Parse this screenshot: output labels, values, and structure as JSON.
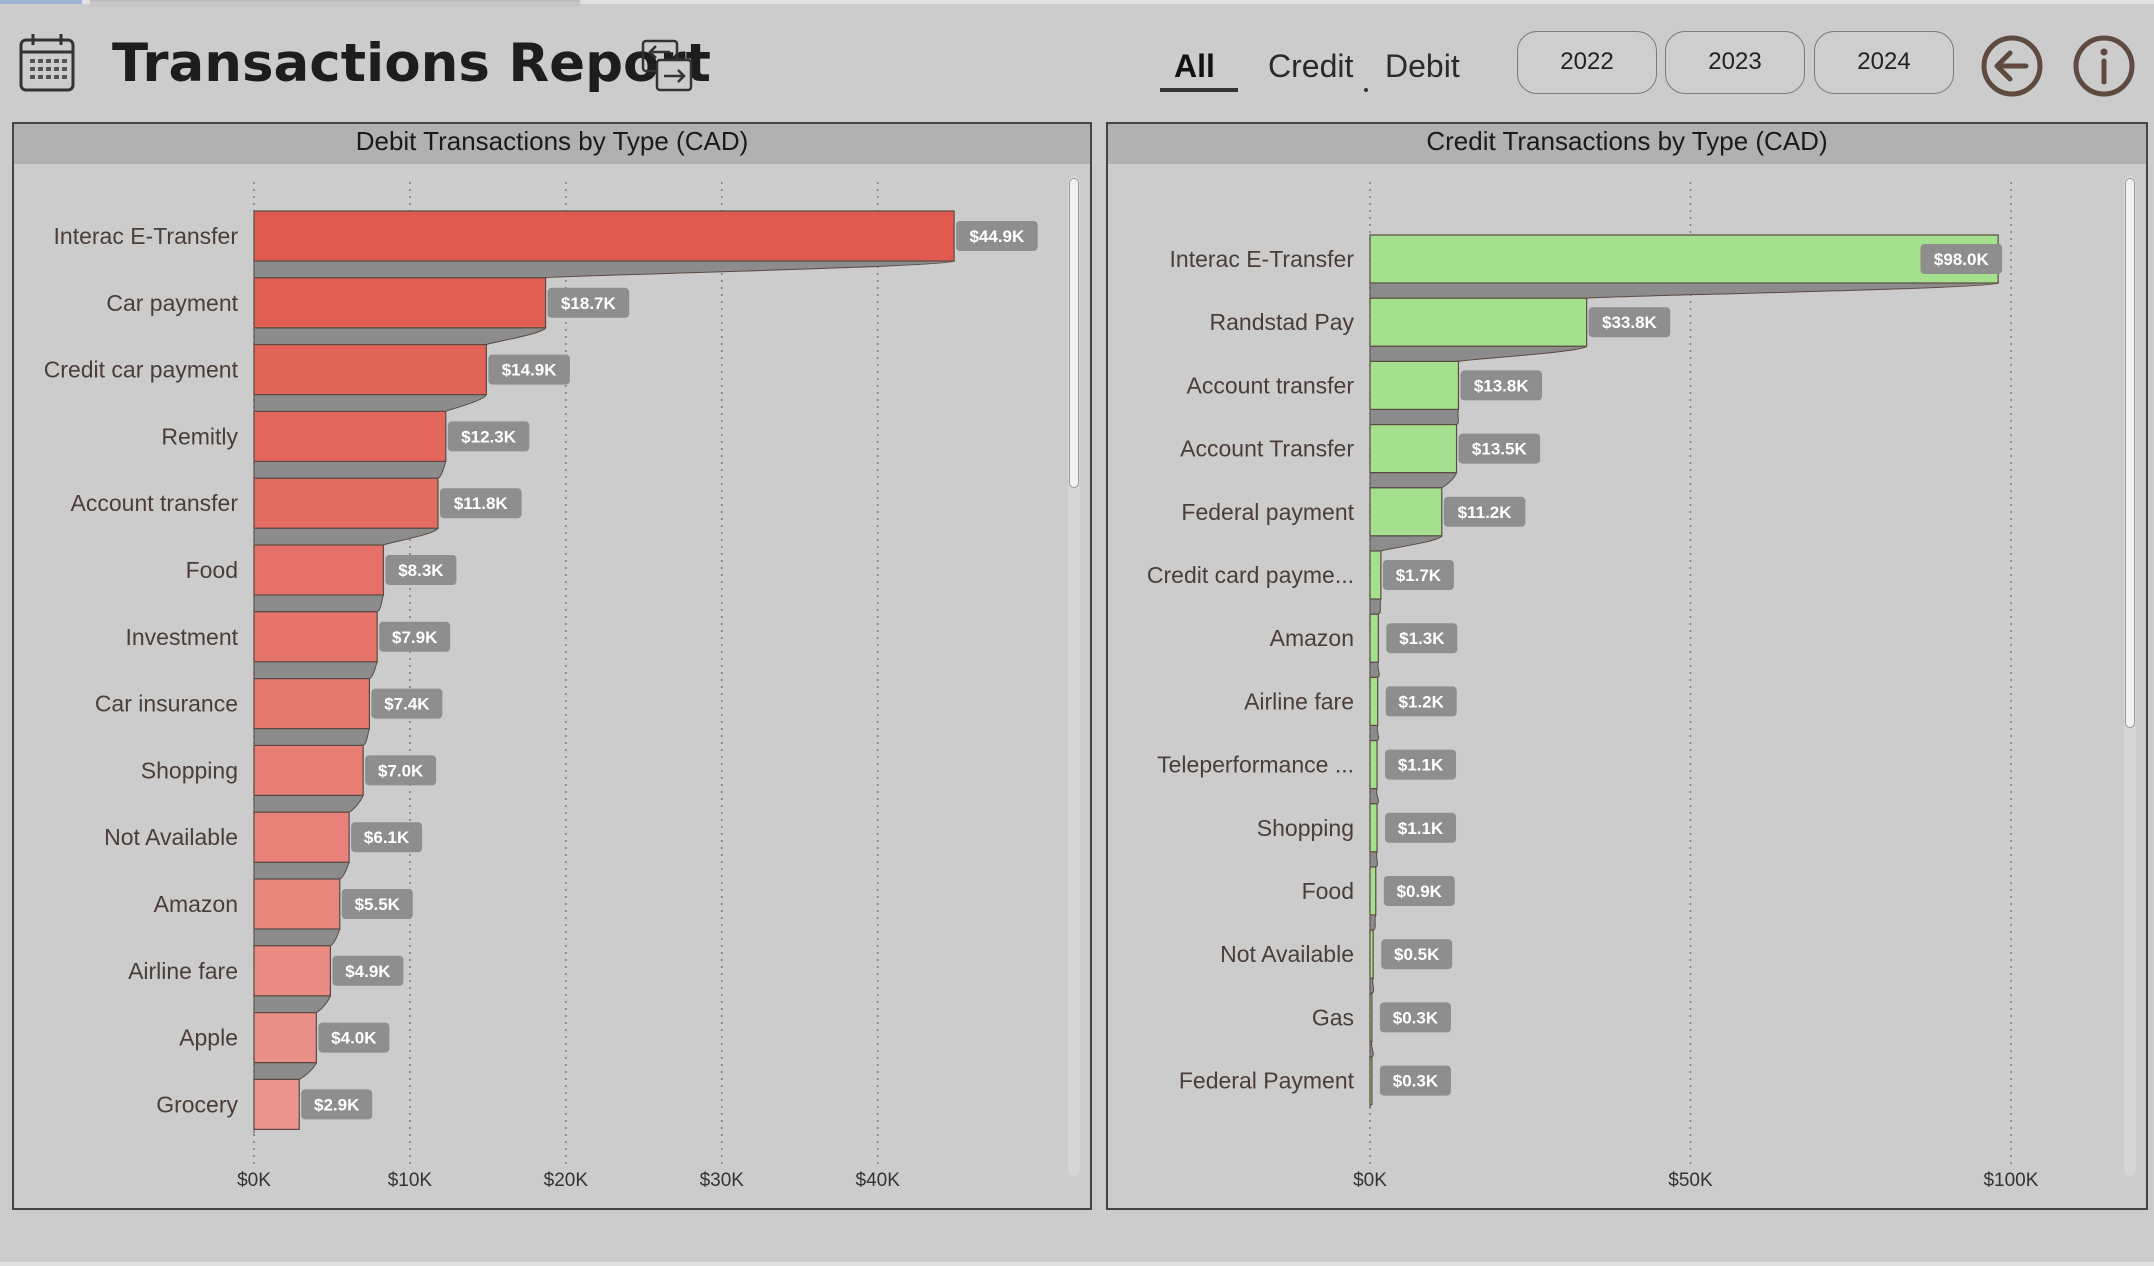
{
  "header": {
    "title": "Transactions Report",
    "icons": {
      "calendar": "calendar-icon",
      "swap": "swap-arrows-icon",
      "back": "arrow-left-circle-icon",
      "info": "info-circle-icon"
    },
    "type_filters": [
      {
        "label": "All",
        "active": true
      },
      {
        "label": "Credit",
        "active": false
      },
      {
        "label": "Debit",
        "active": false
      }
    ],
    "year_filters": [
      "2022",
      "2023",
      "2024"
    ]
  },
  "colors": {
    "background": "#cccccc",
    "panel_header": "#b1b1b1",
    "debit_bar": "#e05a4f",
    "credit_bar": "#a4e08e",
    "data_label_bg": "#8e8e8e",
    "icon_brown": "#5e4a3e"
  },
  "chart_data": [
    {
      "type": "bar",
      "orientation": "horizontal",
      "title": "Debit Transactions by Type (CAD)",
      "categories": [
        "Interac E-Transfer",
        "Car payment",
        "Credit car payment",
        "Remitly",
        "Account transfer",
        "Food",
        "Investment",
        "Car insurance",
        "Shopping",
        "Not Available",
        "Amazon",
        "Airline fare",
        "Apple",
        "Grocery"
      ],
      "values": [
        44.9,
        18.7,
        14.9,
        12.3,
        11.8,
        8.3,
        7.9,
        7.4,
        7.0,
        6.1,
        5.5,
        4.9,
        4.0,
        2.9
      ],
      "value_unit": "K CAD",
      "data_labels": [
        "$44.9K",
        "$18.7K",
        "$14.9K",
        "$12.3K",
        "$11.8K",
        "$8.3K",
        "$7.9K",
        "$7.4K",
        "$7.0K",
        "$6.1K",
        "$5.5K",
        "$4.9K",
        "$4.0K",
        "$2.9K"
      ],
      "x_ticks": [
        0,
        10,
        20,
        30,
        40
      ],
      "x_tick_labels": [
        "$0K",
        "$10K",
        "$20K",
        "$30K",
        "$40K"
      ],
      "xlim": [
        0,
        51.5
      ],
      "grid": "vertical dotted",
      "scrollbar": true
    },
    {
      "type": "bar",
      "orientation": "horizontal",
      "title": "Credit Transactions by Type (CAD)",
      "categories": [
        "Interac E-Transfer",
        "Randstad Pay",
        "Account transfer",
        "Account Transfer",
        "Federal payment",
        "Credit card payme...",
        "Amazon",
        "Airline fare",
        "Teleperformance ...",
        "Shopping",
        "Food",
        "Not Available",
        "Gas",
        "Federal Payment"
      ],
      "values": [
        98.0,
        33.8,
        13.8,
        13.5,
        11.2,
        1.7,
        1.3,
        1.2,
        1.1,
        1.1,
        0.9,
        0.5,
        0.3,
        0.3
      ],
      "value_unit": "K CAD",
      "data_labels": [
        "$98.0K",
        "$33.8K",
        "$13.8K",
        "$13.5K",
        "$11.2K",
        "$1.7K",
        "$1.3K",
        "$1.2K",
        "$1.1K",
        "$1.1K",
        "$0.9K",
        "$0.5K",
        "$0.3K",
        "$0.3K"
      ],
      "x_ticks": [
        0,
        50,
        100
      ],
      "x_tick_labels": [
        "$0K",
        "$50K",
        "$100K"
      ],
      "xlim": [
        0,
        105
      ],
      "grid": "vertical dotted",
      "scrollbar": true
    }
  ]
}
